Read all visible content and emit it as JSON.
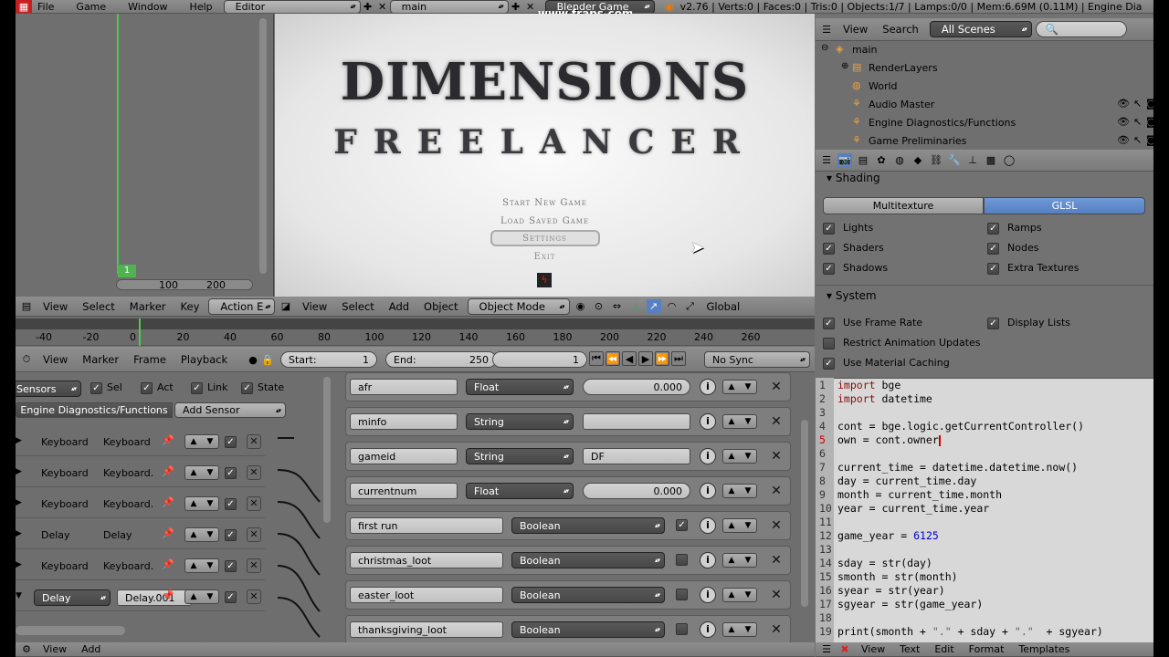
{
  "topbar": {
    "menus": [
      "File",
      "Game",
      "Window",
      "Help"
    ],
    "screen": "Editor",
    "scene": "main",
    "engine": "Blender Game",
    "stats": "v2.76 | Verts:0 | Faces:0 | Tris:0 | Objects:1/7 | Lamps:0/0 | Mem:6.69M (0.11M) | Engine Dia",
    "watermark": "www.fraps.com"
  },
  "timeline_left": {
    "frame_badge": "1",
    "ticks": [
      "100",
      "200"
    ]
  },
  "game_view": {
    "title": "DIMENSIONS",
    "subtitle": "FREELANCER",
    "menu": [
      "Start New Game",
      "Load Saved Game",
      "Settings",
      "Exit"
    ],
    "selected": "Settings"
  },
  "header3d": {
    "left_items": [
      "View",
      "Select",
      "Marker",
      "Key"
    ],
    "action_label": "Action E",
    "items": [
      "View",
      "Select",
      "Add",
      "Object"
    ],
    "mode": "Object Mode",
    "orientation": "Global"
  },
  "ruler": {
    "ticks": [
      "-40",
      "-20",
      "0",
      "20",
      "40",
      "60",
      "80",
      "100",
      "120",
      "140",
      "160",
      "180",
      "200",
      "220",
      "240",
      "260"
    ]
  },
  "timeline": {
    "items": [
      "View",
      "Marker",
      "Frame",
      "Playback"
    ],
    "start_label": "Start:",
    "start": "1",
    "end_label": "End:",
    "end": "250",
    "current": "1",
    "sync": "No Sync"
  },
  "logic": {
    "sensors_label": "Sensors",
    "filters": [
      "Sel",
      "Act",
      "Link",
      "State"
    ],
    "object": "Engine Diagnostics/Functions",
    "add_sensor": "Add Sensor",
    "sensors": [
      {
        "type": "Keyboard",
        "name": "Keyboard"
      },
      {
        "type": "Keyboard",
        "name": "Keyboard."
      },
      {
        "type": "Keyboard",
        "name": "Keyboard."
      },
      {
        "type": "Delay",
        "name": "Delay"
      },
      {
        "type": "Keyboard",
        "name": "Keyboard."
      },
      {
        "type": "Delay",
        "name": "Delay.001"
      }
    ]
  },
  "properties": [
    {
      "name": "afr",
      "type": "Float",
      "value": "0.000",
      "kind": "num"
    },
    {
      "name": "minfo",
      "type": "String",
      "value": "",
      "kind": "str"
    },
    {
      "name": "gameid",
      "type": "String",
      "value": "DF",
      "kind": "str"
    },
    {
      "name": "currentnum",
      "type": "Float",
      "value": "0.000",
      "kind": "num"
    },
    {
      "name": "first run",
      "type": "Boolean",
      "value": "true",
      "kind": "bool"
    },
    {
      "name": "christmas_loot",
      "type": "Boolean",
      "value": "false",
      "kind": "bool"
    },
    {
      "name": "easter_loot",
      "type": "Boolean",
      "value": "false",
      "kind": "bool"
    },
    {
      "name": "thanksgiving_loot",
      "type": "Boolean",
      "value": "false",
      "kind": "bool"
    }
  ],
  "outliner": {
    "items": [
      "View",
      "Search"
    ],
    "scenes": "All Scenes",
    "tree": [
      "main",
      "RenderLayers",
      "World",
      "Audio Master",
      "Engine Diagnostics/Functions",
      "Game Preliminaries"
    ]
  },
  "render": {
    "shading_title": "Shading",
    "tabs": [
      "Multitexture",
      "GLSL"
    ],
    "active_tab": "GLSL",
    "shading_opts": [
      {
        "label": "Lights",
        "on": true
      },
      {
        "label": "Ramps",
        "on": true
      },
      {
        "label": "Shaders",
        "on": true
      },
      {
        "label": "Nodes",
        "on": true
      },
      {
        "label": "Shadows",
        "on": true
      },
      {
        "label": "Extra Textures",
        "on": true
      }
    ],
    "system_title": "System",
    "system_opts": [
      {
        "label": "Use Frame Rate",
        "on": true
      },
      {
        "label": "Display Lists",
        "on": true
      },
      {
        "label": "Restrict Animation Updates",
        "on": false
      },
      {
        "label": "Use Material Caching",
        "on": true
      }
    ]
  },
  "editor": {
    "lines": [
      [
        [
          "kw",
          "import"
        ],
        [
          "t",
          " bge"
        ]
      ],
      [
        [
          "kw",
          "import"
        ],
        [
          "t",
          " datetime"
        ]
      ],
      [
        [
          "t",
          ""
        ]
      ],
      [
        [
          "t",
          "cont = bge.logic.getCurrentController()"
        ]
      ],
      [
        [
          "t",
          "own = cont.owner"
        ]
      ],
      [
        [
          "t",
          ""
        ]
      ],
      [
        [
          "t",
          "current_time = datetime.datetime.now()"
        ]
      ],
      [
        [
          "t",
          "day = current_time.day"
        ]
      ],
      [
        [
          "t",
          "month = current_time.month"
        ]
      ],
      [
        [
          "t",
          "year = current_time.year"
        ]
      ],
      [
        [
          "t",
          ""
        ]
      ],
      [
        [
          "t",
          "game_year = "
        ],
        [
          "num",
          "6125"
        ]
      ],
      [
        [
          "t",
          ""
        ]
      ],
      [
        [
          "t",
          "sday = str(day)"
        ]
      ],
      [
        [
          "t",
          "smonth = str(month)"
        ]
      ],
      [
        [
          "t",
          "syear = str(year)"
        ]
      ],
      [
        [
          "t",
          "sgyear = str(game_year)"
        ]
      ],
      [
        [
          "t",
          ""
        ]
      ],
      [
        [
          "t",
          "print(smonth + "
        ],
        [
          "str",
          "\".\""
        ],
        [
          "t",
          " + sday + "
        ],
        [
          "str",
          "\".\""
        ],
        [
          "t",
          "  + sgyear)"
        ]
      ]
    ],
    "footer": [
      "View",
      "Text",
      "Edit",
      "Format",
      "Templates"
    ]
  },
  "bottom_left": [
    "View",
    "Add"
  ],
  "colors": {
    "accent": "#5680c2",
    "panel": "#727272",
    "game_bg": "#ededed"
  }
}
